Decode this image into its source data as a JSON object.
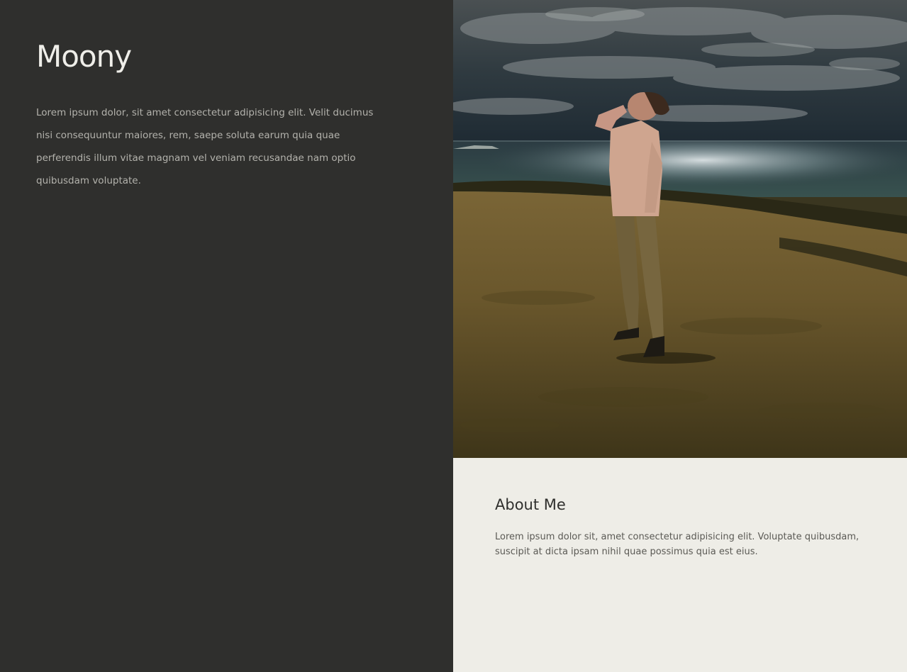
{
  "hero": {
    "title": "Moony",
    "intro": "Lorem ipsum dolor, sit amet consectetur adipisicing elit. Velit ducimus nisi consequuntur maiores, rem, saepe soluta earum quia quae perferendis illum vitae magnam vel veniam recusandae nam optio quibusdam voluptate."
  },
  "about": {
    "title": "About Me",
    "text": "Lorem ipsum dolor sit, amet consectetur adipisicing elit. Voluptate quibusdam, suscipit at dicta ipsam nihil quae possimus quia est eius."
  },
  "colors": {
    "dark_panel": "#2f2f2d",
    "light_panel": "#eeede7",
    "title_text": "#efeee9"
  }
}
